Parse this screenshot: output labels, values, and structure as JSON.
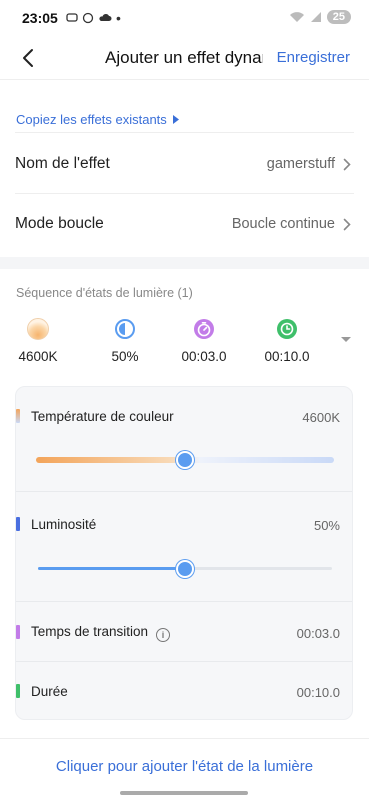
{
  "status_bar": {
    "time": "23:05",
    "battery": "25"
  },
  "header": {
    "title": "Ajouter un effet dynamique",
    "save_label": "Enregistrer"
  },
  "copy_link": "Copiez les effets existants",
  "rows": {
    "effect_name": {
      "label": "Nom de l'effet",
      "value": "gamerstuff"
    },
    "loop_mode": {
      "label": "Mode boucle",
      "value": "Boucle continue"
    }
  },
  "sequence": {
    "title": "Séquence d'états de lumière (1)",
    "summary": [
      {
        "icon": "color-temperature-icon",
        "value": "4600K"
      },
      {
        "icon": "brightness-icon",
        "value": "50%"
      },
      {
        "icon": "transition-time-icon",
        "value": "00:03.0"
      },
      {
        "icon": "duration-clock-icon",
        "value": "00:10.0"
      }
    ]
  },
  "state_card": {
    "color_temperature": {
      "label": "Température de couleur",
      "value": "4600K",
      "slider_fraction": 0.5
    },
    "brightness": {
      "label": "Luminosité",
      "value": "50%",
      "slider_fraction": 0.5
    },
    "transition_time": {
      "label": "Temps de transition",
      "value": "00:03.0"
    },
    "duration": {
      "label": "Durée",
      "value": "00:10.0"
    }
  },
  "add_state_label": "Cliquer pour ajouter l'état de la lumière",
  "colors": {
    "accent_blue": "#3a6fd8",
    "temp_warm": "#f3a45a",
    "temp_cool": "#c9d9f7",
    "brightness_accent": "#4a6fe0",
    "transition_accent": "#c27ce8",
    "duration_accent": "#3fbf6a"
  }
}
